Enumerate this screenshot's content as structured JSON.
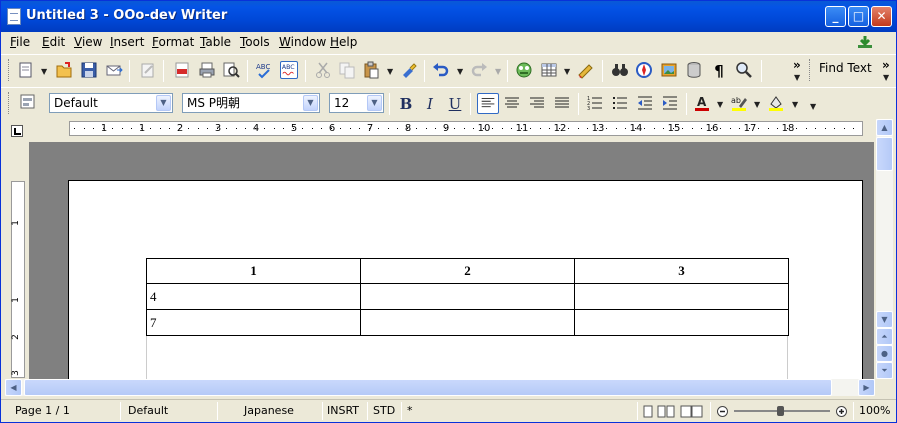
{
  "window": {
    "title": "Untitled 3 - OOo-dev Writer",
    "minimize": "_",
    "maximize": "□",
    "close": "✕"
  },
  "menu": [
    {
      "label": "File",
      "u": "F",
      "rest": "ile"
    },
    {
      "label": "Edit",
      "u": "E",
      "rest": "dit"
    },
    {
      "label": "View",
      "u": "V",
      "rest": "iew"
    },
    {
      "label": "Insert",
      "u": "I",
      "rest": "nsert"
    },
    {
      "label": "Format",
      "u": "F",
      "rest": "ormat"
    },
    {
      "label": "Table",
      "u": "T",
      "rest": "able"
    },
    {
      "label": "Tools",
      "u": "T",
      "rest": "ools"
    },
    {
      "label": "Window",
      "u": "W",
      "rest": "indow"
    },
    {
      "label": "Help",
      "u": "H",
      "rest": "elp"
    }
  ],
  "toolbar": {
    "find_text": "Find Text",
    "overflow": "»"
  },
  "formatting": {
    "style": "Default",
    "font": "MS P明朝",
    "size": "12",
    "bold": "B",
    "italic": "I",
    "underline": "U"
  },
  "ruler": {
    "h_labels": [
      "1",
      "1",
      "2",
      "3",
      "4",
      "5",
      "6",
      "7",
      "8",
      "9",
      "10",
      "11",
      "12",
      "13",
      "14",
      "15",
      "16",
      "17",
      "18"
    ],
    "v_labels": [
      "1",
      "1",
      "2",
      "3"
    ]
  },
  "table": {
    "headers": [
      "1",
      "2",
      "3"
    ],
    "rows": [
      [
        "4",
        "",
        ""
      ],
      [
        "7",
        "",
        ""
      ]
    ]
  },
  "status": {
    "page": "Page 1 / 1",
    "style": "Default",
    "language": "Japanese",
    "insert_mode": "INSRT",
    "selection_mode": "STD",
    "modified": "*",
    "zoom": "100%"
  },
  "colors": {
    "title_bar": "#0453e6",
    "accent": "#316ac5"
  }
}
